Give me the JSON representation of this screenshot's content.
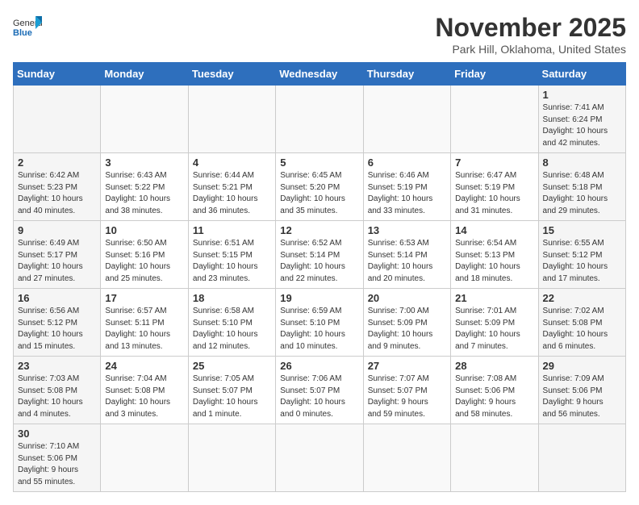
{
  "header": {
    "logo_general": "General",
    "logo_blue": "Blue",
    "title": "November 2025",
    "subtitle": "Park Hill, Oklahoma, United States"
  },
  "days_of_week": [
    "Sunday",
    "Monday",
    "Tuesday",
    "Wednesday",
    "Thursday",
    "Friday",
    "Saturday"
  ],
  "weeks": [
    [
      {
        "day": "",
        "info": ""
      },
      {
        "day": "",
        "info": ""
      },
      {
        "day": "",
        "info": ""
      },
      {
        "day": "",
        "info": ""
      },
      {
        "day": "",
        "info": ""
      },
      {
        "day": "",
        "info": ""
      },
      {
        "day": "1",
        "info": "Sunrise: 7:41 AM\nSunset: 6:24 PM\nDaylight: 10 hours\nand 42 minutes."
      }
    ],
    [
      {
        "day": "2",
        "info": "Sunrise: 6:42 AM\nSunset: 5:23 PM\nDaylight: 10 hours\nand 40 minutes."
      },
      {
        "day": "3",
        "info": "Sunrise: 6:43 AM\nSunset: 5:22 PM\nDaylight: 10 hours\nand 38 minutes."
      },
      {
        "day": "4",
        "info": "Sunrise: 6:44 AM\nSunset: 5:21 PM\nDaylight: 10 hours\nand 36 minutes."
      },
      {
        "day": "5",
        "info": "Sunrise: 6:45 AM\nSunset: 5:20 PM\nDaylight: 10 hours\nand 35 minutes."
      },
      {
        "day": "6",
        "info": "Sunrise: 6:46 AM\nSunset: 5:19 PM\nDaylight: 10 hours\nand 33 minutes."
      },
      {
        "day": "7",
        "info": "Sunrise: 6:47 AM\nSunset: 5:19 PM\nDaylight: 10 hours\nand 31 minutes."
      },
      {
        "day": "8",
        "info": "Sunrise: 6:48 AM\nSunset: 5:18 PM\nDaylight: 10 hours\nand 29 minutes."
      }
    ],
    [
      {
        "day": "9",
        "info": "Sunrise: 6:49 AM\nSunset: 5:17 PM\nDaylight: 10 hours\nand 27 minutes."
      },
      {
        "day": "10",
        "info": "Sunrise: 6:50 AM\nSunset: 5:16 PM\nDaylight: 10 hours\nand 25 minutes."
      },
      {
        "day": "11",
        "info": "Sunrise: 6:51 AM\nSunset: 5:15 PM\nDaylight: 10 hours\nand 23 minutes."
      },
      {
        "day": "12",
        "info": "Sunrise: 6:52 AM\nSunset: 5:14 PM\nDaylight: 10 hours\nand 22 minutes."
      },
      {
        "day": "13",
        "info": "Sunrise: 6:53 AM\nSunset: 5:14 PM\nDaylight: 10 hours\nand 20 minutes."
      },
      {
        "day": "14",
        "info": "Sunrise: 6:54 AM\nSunset: 5:13 PM\nDaylight: 10 hours\nand 18 minutes."
      },
      {
        "day": "15",
        "info": "Sunrise: 6:55 AM\nSunset: 5:12 PM\nDaylight: 10 hours\nand 17 minutes."
      }
    ],
    [
      {
        "day": "16",
        "info": "Sunrise: 6:56 AM\nSunset: 5:12 PM\nDaylight: 10 hours\nand 15 minutes."
      },
      {
        "day": "17",
        "info": "Sunrise: 6:57 AM\nSunset: 5:11 PM\nDaylight: 10 hours\nand 13 minutes."
      },
      {
        "day": "18",
        "info": "Sunrise: 6:58 AM\nSunset: 5:10 PM\nDaylight: 10 hours\nand 12 minutes."
      },
      {
        "day": "19",
        "info": "Sunrise: 6:59 AM\nSunset: 5:10 PM\nDaylight: 10 hours\nand 10 minutes."
      },
      {
        "day": "20",
        "info": "Sunrise: 7:00 AM\nSunset: 5:09 PM\nDaylight: 10 hours\nand 9 minutes."
      },
      {
        "day": "21",
        "info": "Sunrise: 7:01 AM\nSunset: 5:09 PM\nDaylight: 10 hours\nand 7 minutes."
      },
      {
        "day": "22",
        "info": "Sunrise: 7:02 AM\nSunset: 5:08 PM\nDaylight: 10 hours\nand 6 minutes."
      }
    ],
    [
      {
        "day": "23",
        "info": "Sunrise: 7:03 AM\nSunset: 5:08 PM\nDaylight: 10 hours\nand 4 minutes."
      },
      {
        "day": "24",
        "info": "Sunrise: 7:04 AM\nSunset: 5:08 PM\nDaylight: 10 hours\nand 3 minutes."
      },
      {
        "day": "25",
        "info": "Sunrise: 7:05 AM\nSunset: 5:07 PM\nDaylight: 10 hours\nand 1 minute."
      },
      {
        "day": "26",
        "info": "Sunrise: 7:06 AM\nSunset: 5:07 PM\nDaylight: 10 hours\nand 0 minutes."
      },
      {
        "day": "27",
        "info": "Sunrise: 7:07 AM\nSunset: 5:07 PM\nDaylight: 9 hours\nand 59 minutes."
      },
      {
        "day": "28",
        "info": "Sunrise: 7:08 AM\nSunset: 5:06 PM\nDaylight: 9 hours\nand 58 minutes."
      },
      {
        "day": "29",
        "info": "Sunrise: 7:09 AM\nSunset: 5:06 PM\nDaylight: 9 hours\nand 56 minutes."
      }
    ],
    [
      {
        "day": "30",
        "info": "Sunrise: 7:10 AM\nSunset: 5:06 PM\nDaylight: 9 hours\nand 55 minutes."
      },
      {
        "day": "",
        "info": ""
      },
      {
        "day": "",
        "info": ""
      },
      {
        "day": "",
        "info": ""
      },
      {
        "day": "",
        "info": ""
      },
      {
        "day": "",
        "info": ""
      },
      {
        "day": "",
        "info": ""
      }
    ]
  ]
}
